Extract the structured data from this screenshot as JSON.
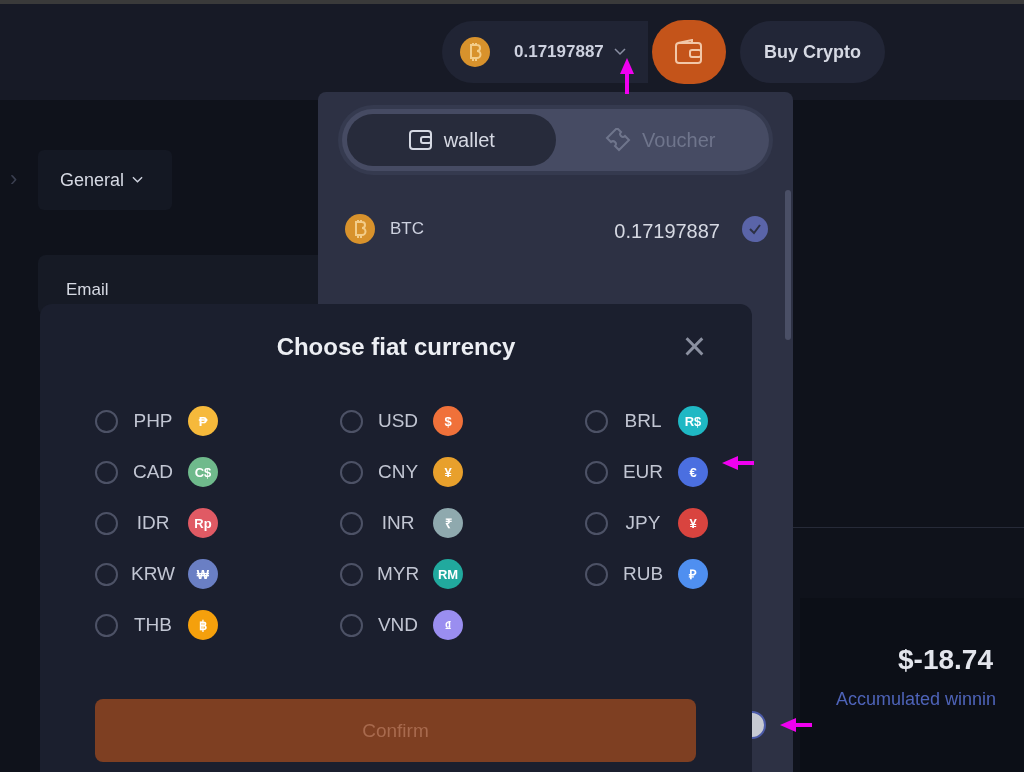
{
  "header": {
    "balance": "0.17197887",
    "buy_button": "Buy Crypto"
  },
  "sidebar": {
    "expand_arrow": "›",
    "general_dropdown": "General"
  },
  "account_card": {
    "label": "Email"
  },
  "stats_card": {
    "value": "$-18.74",
    "label": "Accumulated winnin"
  },
  "wallet_dropdown": {
    "tabs": [
      {
        "label": "wallet",
        "selected": true
      },
      {
        "label": "Voucher",
        "selected": false
      }
    ],
    "coins": [
      {
        "name": "BTC",
        "amount": "0.17197887",
        "checked": true
      }
    ]
  },
  "currency_modal": {
    "title": "Choose fiat currency",
    "close": "×",
    "currencies": [
      {
        "code": "PHP",
        "symbol": "₱",
        "color": "#f6b93b",
        "selected": false
      },
      {
        "code": "USD",
        "symbol": "$",
        "color": "#f0713a",
        "selected": false
      },
      {
        "code": "BRL",
        "symbol": "R$",
        "color": "#1fb8c4",
        "selected": false
      },
      {
        "code": "CAD",
        "symbol": "C$",
        "color": "#6fba8c",
        "selected": false
      },
      {
        "code": "CNY",
        "symbol": "¥",
        "color": "#e8a02c",
        "selected": false
      },
      {
        "code": "EUR",
        "symbol": "€",
        "color": "#4b6fe0",
        "selected": false
      },
      {
        "code": "IDR",
        "symbol": "Rp",
        "color": "#e05a64",
        "selected": false
      },
      {
        "code": "INR",
        "symbol": "₹",
        "color": "#8fa9ae",
        "selected": false
      },
      {
        "code": "JPY",
        "symbol": "¥",
        "color": "#d9443f",
        "selected": false
      },
      {
        "code": "KRW",
        "symbol": "₩",
        "color": "#6a7fc4",
        "selected": false
      },
      {
        "code": "MYR",
        "symbol": "RM",
        "color": "#21a99e",
        "selected": false
      },
      {
        "code": "RUB",
        "symbol": "₽",
        "color": "#4f8ff0",
        "selected": false
      },
      {
        "code": "THB",
        "symbol": "฿",
        "color": "#f5a00c",
        "selected": false
      },
      {
        "code": "VND",
        "symbol": "₫",
        "color": "#9a8ef0",
        "selected": false
      }
    ],
    "confirm": {
      "label": "Confirm",
      "disabled": true
    }
  }
}
